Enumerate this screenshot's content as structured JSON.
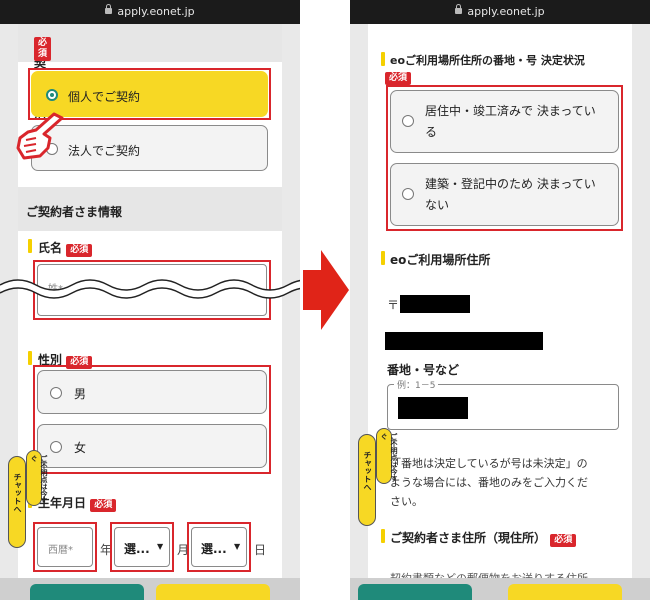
{
  "left": {
    "url": "apply.eonet.jp",
    "contract_type": {
      "title": "ご契約種別",
      "required": "必須",
      "options": [
        "個人でご契約",
        "法人でご契約"
      ]
    },
    "contractor_info": {
      "title": "ご契約者さま情報"
    },
    "name": {
      "label": "氏名",
      "required": "必須",
      "placeholder": "姓*"
    },
    "gender": {
      "label": "性別",
      "required": "必須",
      "options": [
        "男",
        "女"
      ]
    },
    "birthday": {
      "label": "生年月日",
      "required": "必須",
      "era_placeholder": "西暦*",
      "year_unit": "年",
      "month_select": "選...",
      "month_unit": "月",
      "day_select": "選...",
      "day_unit": "日"
    },
    "chat": {
      "label": "チャットへ",
      "sub": "ご不明点は今すぐ"
    }
  },
  "right": {
    "url": "apply.eonet.jp",
    "address_status": {
      "label": "eoご利用場所住所の番地・号 決定状況",
      "required": "必須",
      "option1_line1": "居住中・竣工済みで 決まってい",
      "option1_line2": "る",
      "option2_line1": "建築・登記中のため 決まってい",
      "option2_line2": "ない"
    },
    "usage_address": {
      "label": "eoご利用場所住所",
      "postal_mark": "〒"
    },
    "street": {
      "label": "番地・号など",
      "hint": "例：1－5"
    },
    "note": {
      "line1": "「番地は決定しているが号は未決定」の",
      "line2": "ような場合には、番地のみをご入力くだ",
      "line3": "さい。"
    },
    "current_address": {
      "label": "ご契約者さま住所（現住所）",
      "required": "必須"
    },
    "bottom_text": "契約書類などの郵便物をお送りする住所",
    "chat": {
      "label": "チャットへ",
      "sub": "ご不明点は今すぐ"
    }
  }
}
